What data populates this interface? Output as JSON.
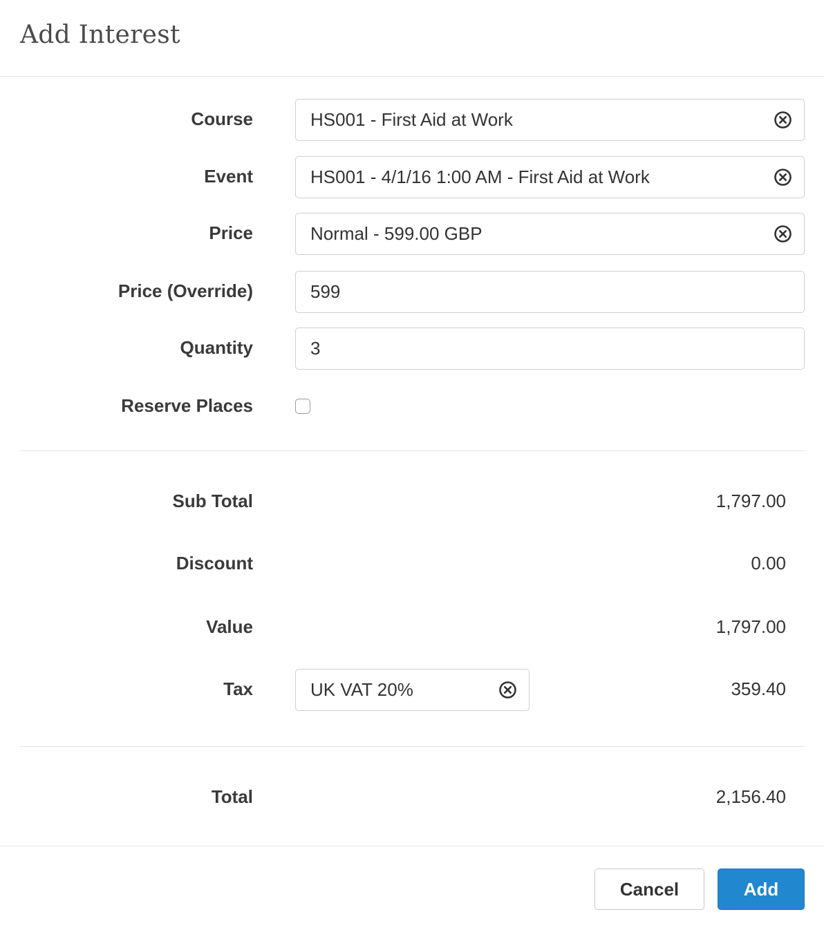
{
  "dialog": {
    "title": "Add Interest"
  },
  "form": {
    "course": {
      "label": "Course",
      "value": "HS001 - First Aid at Work"
    },
    "event": {
      "label": "Event",
      "value": "HS001 - 4/1/16 1:00 AM - First Aid at Work"
    },
    "price": {
      "label": "Price",
      "value": "Normal - 599.00 GBP"
    },
    "price_override": {
      "label": "Price (Override)",
      "value": "599"
    },
    "quantity": {
      "label": "Quantity",
      "value": "3"
    },
    "reserve_places": {
      "label": "Reserve Places",
      "checked": false
    }
  },
  "summary": {
    "sub_total": {
      "label": "Sub Total",
      "value": "1,797.00"
    },
    "discount": {
      "label": "Discount",
      "value": "0.00"
    },
    "value": {
      "label": "Value",
      "value": "1,797.00"
    },
    "tax": {
      "label": "Tax",
      "selection": "UK VAT 20%",
      "value": "359.40"
    },
    "total": {
      "label": "Total",
      "value": "2,156.40"
    }
  },
  "buttons": {
    "cancel": "Cancel",
    "add": "Add"
  },
  "colors": {
    "primary": "#2187cf",
    "border": "#cfcfcf",
    "divider": "#e3e3e3"
  },
  "icons": {
    "clear": "circle-x-icon"
  }
}
